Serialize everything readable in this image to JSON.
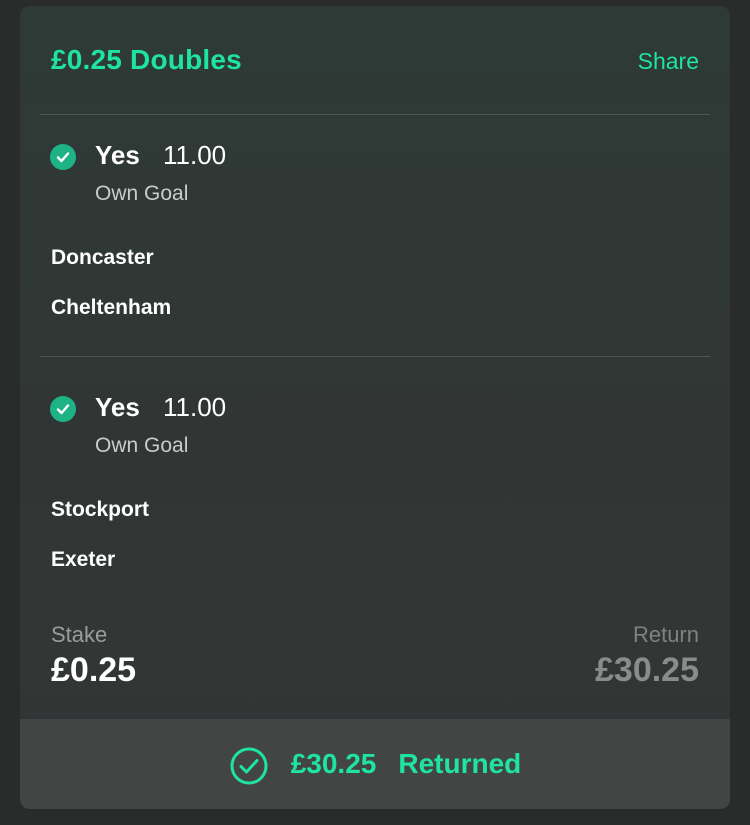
{
  "bet": {
    "title": "£0.25 Doubles",
    "share_label": "Share"
  },
  "selections": [
    {
      "name": "Yes",
      "odds": "11.00",
      "market": "Own Goal",
      "teams": [
        "Doncaster",
        "Cheltenham"
      ],
      "status_icon": "check-circle-icon"
    },
    {
      "name": "Yes",
      "odds": "11.00",
      "market": "Own Goal",
      "teams": [
        "Stockport",
        "Exeter"
      ],
      "status_icon": "check-circle-icon"
    }
  ],
  "summary": {
    "stake_label": "Stake",
    "stake_value": "£0.25",
    "return_label": "Return",
    "return_value": "£30.25"
  },
  "footer": {
    "amount": "£30.25",
    "status": "Returned",
    "icon": "check-circle-outline-icon"
  },
  "colors": {
    "accent": "#1fe3a0",
    "check_fill": "#1db385",
    "card_bg": "#313634",
    "footer_bg": "#434545",
    "page_bg": "#2a2b2b"
  }
}
